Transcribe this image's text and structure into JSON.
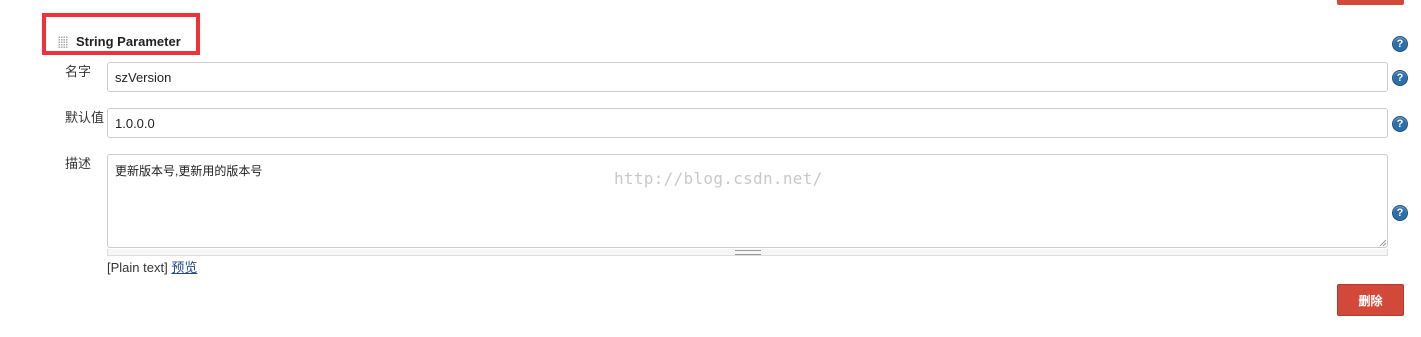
{
  "section": {
    "title": "String Parameter"
  },
  "fields": {
    "name": {
      "label": "名字",
      "value": "szVersion"
    },
    "default_value": {
      "label": "默认值",
      "value": "1.0.0.0"
    },
    "description": {
      "label": "描述",
      "value": "更新版本号,更新用的版本号"
    }
  },
  "syntax": {
    "mode_text": "[Plain text]",
    "preview_link": "预览"
  },
  "watermark": "http://blog.csdn.net/",
  "actions": {
    "delete_label": "删除"
  },
  "icons": {
    "help": "?",
    "help_icon_name": "help-icon"
  },
  "colors": {
    "highlight_border": "#f0313b",
    "delete_button": "#d24939",
    "help_icon": "#2f6fa8",
    "link": "#204a87"
  }
}
